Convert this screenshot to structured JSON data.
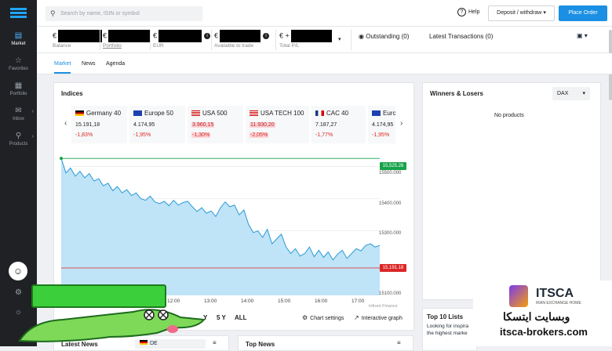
{
  "sidebar": {
    "items": [
      {
        "label": "Market",
        "icon": "chart-icon"
      },
      {
        "label": "Favorites",
        "icon": "star-icon"
      },
      {
        "label": "Portfolio",
        "icon": "portfolio-icon"
      },
      {
        "label": "Inbox",
        "icon": "mail-icon"
      },
      {
        "label": "Products",
        "icon": "search-products-icon"
      }
    ]
  },
  "topbar": {
    "search_placeholder": "Search by name, ISIN or symbol",
    "help": "Help",
    "deposit": "Deposit / withdraw",
    "place_order": "Place Order"
  },
  "account": {
    "currency": "€",
    "fields": [
      {
        "label": "Balance"
      },
      {
        "label": "Portfolio"
      },
      {
        "label": "EUR"
      },
      {
        "label": "Available to trade"
      },
      {
        "label": "Total P/L",
        "prefix": "€ +"
      }
    ],
    "outstanding": "Outstanding (0)",
    "latest_transactions": "Latest Transactions (0)"
  },
  "tabs": [
    "Market",
    "News",
    "Agenda"
  ],
  "indices": {
    "title": "Indices",
    "items": [
      {
        "name": "Germany 40",
        "price": "15.191,18",
        "change": "-1,83%",
        "flag": "de"
      },
      {
        "name": "Europe 50",
        "price": "4.174,95",
        "change": "-1,95%",
        "flag": "eu"
      },
      {
        "name": "USA 500",
        "price": "3.960,15",
        "change": "-1,30%",
        "flag": "us"
      },
      {
        "name": "USA TECH 100",
        "price": "11.930,20",
        "change": "-2,05%",
        "flag": "us"
      },
      {
        "name": "CAC 40",
        "price": "7.187,27",
        "change": "-1,77%",
        "flag": "fr"
      },
      {
        "name": "Euro",
        "price": "4.174,95",
        "change": "-1,95%",
        "flag": "eu"
      }
    ]
  },
  "chart_data": {
    "type": "area",
    "y_ticks": [
      "15500.000",
      "15400.000",
      "15300.000",
      "15100.000"
    ],
    "x_ticks": [
      "12:00",
      "13:00",
      "14:00",
      "15:00",
      "16:00",
      "17:00"
    ],
    "ylim": [
      15100,
      15540
    ],
    "high_label": "15,525.26",
    "last_label": "15,191.18",
    "source": "Infront Finance",
    "series": [
      {
        "values": [
          15525,
          15480,
          15495,
          15470,
          15485,
          15465,
          15478,
          15455,
          15462,
          15440,
          15448,
          15425,
          15438,
          15418,
          15428,
          15410,
          15418,
          15400,
          15395,
          15408,
          15390,
          15385,
          15392,
          15378,
          15395,
          15380,
          15388,
          15392,
          15375,
          15360,
          15372,
          15355,
          15362,
          15345,
          15372,
          15390,
          15375,
          15380,
          15350,
          15365,
          15320,
          15295,
          15300,
          15280,
          15305,
          15260,
          15275,
          15290,
          15250,
          15230,
          15245,
          15222,
          15230,
          15250,
          15220,
          15240,
          15218,
          15235,
          15210,
          15228,
          15240,
          15215,
          15230,
          15245,
          15238,
          15255,
          15260,
          15250,
          15255
        ]
      }
    ]
  },
  "chart_controls": {
    "periods": [
      "Y",
      "5 Y",
      "ALL"
    ],
    "settings": "Chart settings",
    "interactive": "Interactive graph"
  },
  "winners": {
    "title": "Winners & Losers",
    "index": "DAX",
    "empty": "No products"
  },
  "latest_news": {
    "title": "Latest News",
    "country": "DE"
  },
  "top_news": {
    "title": "Top News"
  },
  "top10": {
    "title": "Top 10 Lists",
    "text1": "Looking for inspira",
    "text2": "the highest marke"
  },
  "brand": {
    "name": "ITSCA",
    "tagline": "IRAN EXCHANGE HOME",
    "site": "itsca-brokers.com",
    "arabic": "وبسایت ایتسکا"
  }
}
